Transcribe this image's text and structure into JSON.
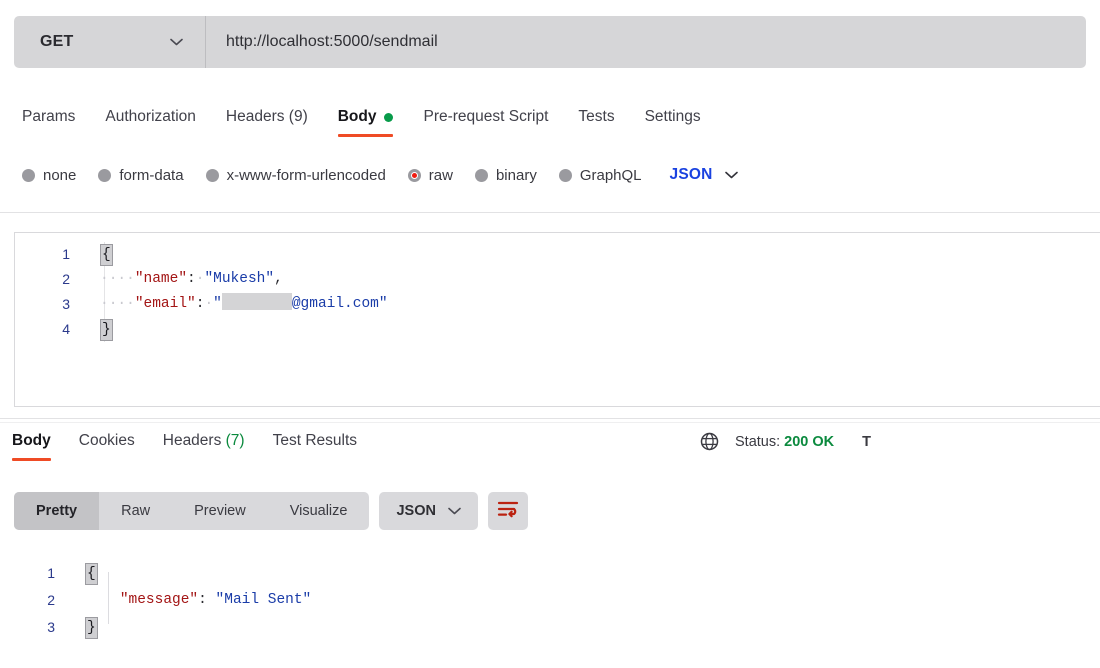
{
  "request_bar": {
    "method": "GET",
    "method_chevron_icon": "chevron-down-icon",
    "url": "http://localhost:5000/sendmail"
  },
  "request_tabs": [
    {
      "label": "Params",
      "active": false
    },
    {
      "label": "Authorization",
      "active": false
    },
    {
      "label": "Headers (9)",
      "active": false
    },
    {
      "label": "Body",
      "active": true,
      "indicator": "green-dot"
    },
    {
      "label": "Pre-request Script",
      "active": false
    },
    {
      "label": "Tests",
      "active": false
    },
    {
      "label": "Settings",
      "active": false
    }
  ],
  "body_type": {
    "options": [
      {
        "label": "none",
        "selected": false
      },
      {
        "label": "form-data",
        "selected": false
      },
      {
        "label": "x-www-form-urlencoded",
        "selected": false
      },
      {
        "label": "raw",
        "selected": true
      },
      {
        "label": "binary",
        "selected": false
      },
      {
        "label": "GraphQL",
        "selected": false
      }
    ],
    "format": "JSON",
    "format_chevron_icon": "chevron-down-icon"
  },
  "request_body": {
    "lines": [
      {
        "num": "1",
        "open_brace": "{"
      },
      {
        "num": "2",
        "indent": "····",
        "key": "\"name\"",
        "colon": ":",
        "space": "·",
        "value": "\"Mukesh\"",
        "comma": ","
      },
      {
        "num": "3",
        "indent": "····",
        "key": "\"email\"",
        "colon": ":",
        "space": "·",
        "value_prefix": "\"",
        "redacted": true,
        "value_suffix": "@gmail.com\""
      },
      {
        "num": "4",
        "close_brace": "}"
      }
    ]
  },
  "response_tabs": [
    {
      "label": "Body",
      "active": true
    },
    {
      "label": "Cookies",
      "active": false
    },
    {
      "label": "Headers",
      "count": " (7)",
      "active": false
    },
    {
      "label": "Test Results",
      "active": false
    }
  ],
  "response_status": {
    "globe_icon": "globe-icon",
    "status_label": "Status:",
    "status_value": "200 OK",
    "time_truncated": "T"
  },
  "response_toolbar": {
    "views": [
      {
        "label": "Pretty",
        "active": true
      },
      {
        "label": "Raw",
        "active": false
      },
      {
        "label": "Preview",
        "active": false
      },
      {
        "label": "Visualize",
        "active": false
      }
    ],
    "format": "JSON",
    "format_chevron_icon": "chevron-down-icon",
    "wrap_icon": "wrap-text-icon"
  },
  "response_body": {
    "lines": [
      {
        "num": "1",
        "open_brace": "{"
      },
      {
        "num": "2",
        "indent": "    ",
        "key": "\"message\"",
        "colon": ": ",
        "value": "\"Mail Sent\""
      },
      {
        "num": "3",
        "close_brace": "}"
      }
    ]
  },
  "colors": {
    "accent_red": "#ef4b25",
    "green": "#089b4a",
    "blue": "#1a42e0",
    "json_key": "#a31515",
    "json_string": "#1a3ca8"
  }
}
